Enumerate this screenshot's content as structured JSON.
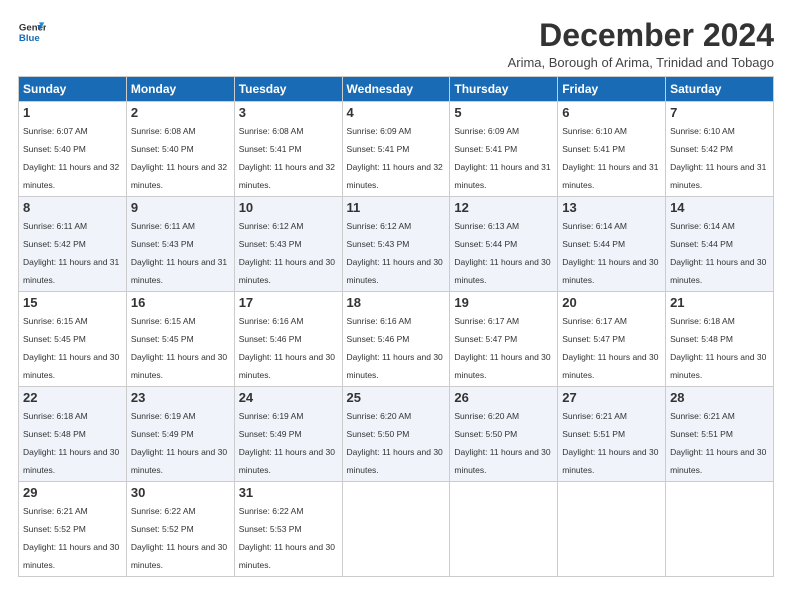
{
  "header": {
    "logo_line1": "General",
    "logo_line2": "Blue",
    "title": "December 2024",
    "subtitle": "Arima, Borough of Arima, Trinidad and Tobago"
  },
  "weekdays": [
    "Sunday",
    "Monday",
    "Tuesday",
    "Wednesday",
    "Thursday",
    "Friday",
    "Saturday"
  ],
  "weeks": [
    [
      {
        "day": "1",
        "sunrise": "6:07 AM",
        "sunset": "5:40 PM",
        "daylight": "11 hours and 32 minutes."
      },
      {
        "day": "2",
        "sunrise": "6:08 AM",
        "sunset": "5:40 PM",
        "daylight": "11 hours and 32 minutes."
      },
      {
        "day": "3",
        "sunrise": "6:08 AM",
        "sunset": "5:41 PM",
        "daylight": "11 hours and 32 minutes."
      },
      {
        "day": "4",
        "sunrise": "6:09 AM",
        "sunset": "5:41 PM",
        "daylight": "11 hours and 32 minutes."
      },
      {
        "day": "5",
        "sunrise": "6:09 AM",
        "sunset": "5:41 PM",
        "daylight": "11 hours and 31 minutes."
      },
      {
        "day": "6",
        "sunrise": "6:10 AM",
        "sunset": "5:41 PM",
        "daylight": "11 hours and 31 minutes."
      },
      {
        "day": "7",
        "sunrise": "6:10 AM",
        "sunset": "5:42 PM",
        "daylight": "11 hours and 31 minutes."
      }
    ],
    [
      {
        "day": "8",
        "sunrise": "6:11 AM",
        "sunset": "5:42 PM",
        "daylight": "11 hours and 31 minutes."
      },
      {
        "day": "9",
        "sunrise": "6:11 AM",
        "sunset": "5:43 PM",
        "daylight": "11 hours and 31 minutes."
      },
      {
        "day": "10",
        "sunrise": "6:12 AM",
        "sunset": "5:43 PM",
        "daylight": "11 hours and 30 minutes."
      },
      {
        "day": "11",
        "sunrise": "6:12 AM",
        "sunset": "5:43 PM",
        "daylight": "11 hours and 30 minutes."
      },
      {
        "day": "12",
        "sunrise": "6:13 AM",
        "sunset": "5:44 PM",
        "daylight": "11 hours and 30 minutes."
      },
      {
        "day": "13",
        "sunrise": "6:14 AM",
        "sunset": "5:44 PM",
        "daylight": "11 hours and 30 minutes."
      },
      {
        "day": "14",
        "sunrise": "6:14 AM",
        "sunset": "5:44 PM",
        "daylight": "11 hours and 30 minutes."
      }
    ],
    [
      {
        "day": "15",
        "sunrise": "6:15 AM",
        "sunset": "5:45 PM",
        "daylight": "11 hours and 30 minutes."
      },
      {
        "day": "16",
        "sunrise": "6:15 AM",
        "sunset": "5:45 PM",
        "daylight": "11 hours and 30 minutes."
      },
      {
        "day": "17",
        "sunrise": "6:16 AM",
        "sunset": "5:46 PM",
        "daylight": "11 hours and 30 minutes."
      },
      {
        "day": "18",
        "sunrise": "6:16 AM",
        "sunset": "5:46 PM",
        "daylight": "11 hours and 30 minutes."
      },
      {
        "day": "19",
        "sunrise": "6:17 AM",
        "sunset": "5:47 PM",
        "daylight": "11 hours and 30 minutes."
      },
      {
        "day": "20",
        "sunrise": "6:17 AM",
        "sunset": "5:47 PM",
        "daylight": "11 hours and 30 minutes."
      },
      {
        "day": "21",
        "sunrise": "6:18 AM",
        "sunset": "5:48 PM",
        "daylight": "11 hours and 30 minutes."
      }
    ],
    [
      {
        "day": "22",
        "sunrise": "6:18 AM",
        "sunset": "5:48 PM",
        "daylight": "11 hours and 30 minutes."
      },
      {
        "day": "23",
        "sunrise": "6:19 AM",
        "sunset": "5:49 PM",
        "daylight": "11 hours and 30 minutes."
      },
      {
        "day": "24",
        "sunrise": "6:19 AM",
        "sunset": "5:49 PM",
        "daylight": "11 hours and 30 minutes."
      },
      {
        "day": "25",
        "sunrise": "6:20 AM",
        "sunset": "5:50 PM",
        "daylight": "11 hours and 30 minutes."
      },
      {
        "day": "26",
        "sunrise": "6:20 AM",
        "sunset": "5:50 PM",
        "daylight": "11 hours and 30 minutes."
      },
      {
        "day": "27",
        "sunrise": "6:21 AM",
        "sunset": "5:51 PM",
        "daylight": "11 hours and 30 minutes."
      },
      {
        "day": "28",
        "sunrise": "6:21 AM",
        "sunset": "5:51 PM",
        "daylight": "11 hours and 30 minutes."
      }
    ],
    [
      {
        "day": "29",
        "sunrise": "6:21 AM",
        "sunset": "5:52 PM",
        "daylight": "11 hours and 30 minutes."
      },
      {
        "day": "30",
        "sunrise": "6:22 AM",
        "sunset": "5:52 PM",
        "daylight": "11 hours and 30 minutes."
      },
      {
        "day": "31",
        "sunrise": "6:22 AM",
        "sunset": "5:53 PM",
        "daylight": "11 hours and 30 minutes."
      },
      null,
      null,
      null,
      null
    ]
  ]
}
